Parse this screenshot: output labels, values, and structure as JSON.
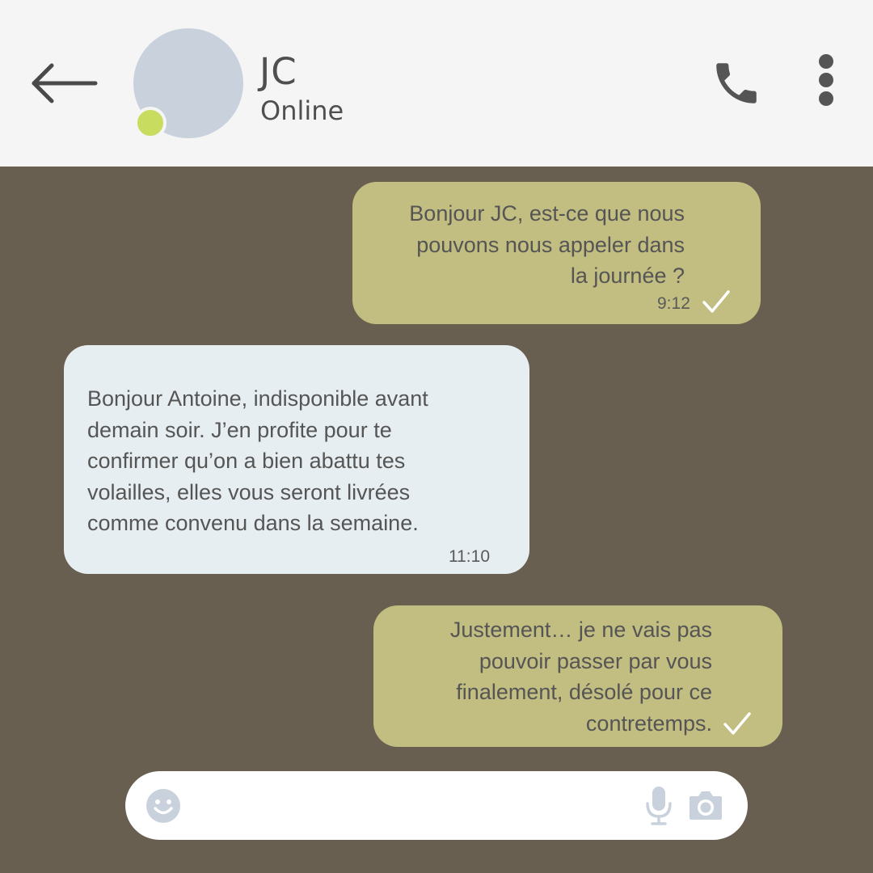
{
  "header": {
    "contact_name": "JC",
    "status": "Online",
    "back_icon": "arrow-left-icon",
    "call_icon": "phone-icon",
    "menu_icon": "more-vertical-icon",
    "presence_color": "#c8dc60"
  },
  "messages": [
    {
      "direction": "outgoing",
      "text": "Bonjour JC, est-ce que nous\npouvons nous appeler dans\nla journée ?",
      "time": "9:12",
      "read": true
    },
    {
      "direction": "incoming",
      "text": "Bonjour Antoine, indisponible avant\ndemain soir. J’en profite pour te\nconfirmer qu’on a bien abattu tes\nvolailles, elles vous seront livrées\ncomme convenu dans la semaine.",
      "time": "11:10"
    },
    {
      "direction": "outgoing",
      "text": "Justement… je ne vais pas\npouvoir passer par vous\nfinalement, désolé pour ce\ncontretemps.",
      "read": true
    }
  ],
  "composer": {
    "value": "",
    "emoji_icon": "emoji-icon",
    "mic_icon": "microphone-icon",
    "camera_icon": "camera-icon"
  },
  "colors": {
    "chat_background": "#685f50",
    "outgoing_bubble": "#c2bd80",
    "incoming_bubble": "#e7eef1",
    "header_background": "#f5f5f5"
  }
}
